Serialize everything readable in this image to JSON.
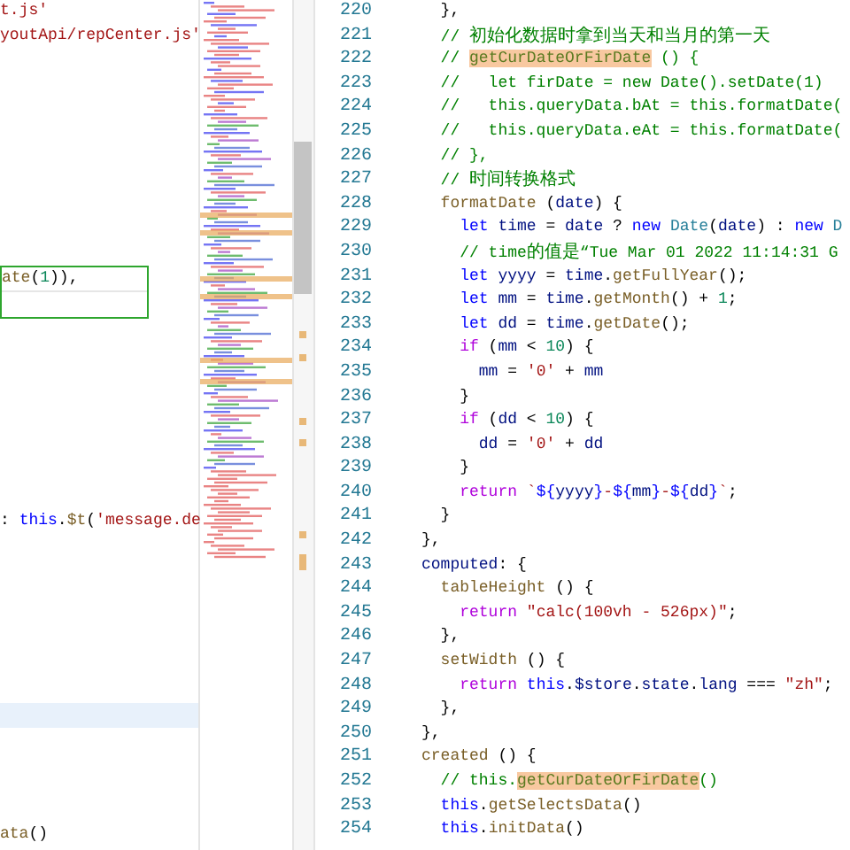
{
  "left_pane": {
    "lines": [
      {
        "kind": "code",
        "tokens": [
          {
            "kind": "string",
            "text": "t.js'"
          }
        ]
      },
      {
        "kind": "code",
        "tokens": [
          {
            "kind": "string",
            "text": "youtApi/repCenter.js'"
          }
        ]
      },
      {
        "kind": "blank"
      },
      {
        "kind": "blank"
      },
      {
        "kind": "blank"
      },
      {
        "kind": "blank"
      },
      {
        "kind": "blank"
      },
      {
        "kind": "blank"
      },
      {
        "kind": "blank"
      },
      {
        "kind": "blank"
      },
      {
        "kind": "blank"
      },
      {
        "kind": "code",
        "boxed": true,
        "tokens": [
          {
            "kind": "function",
            "text": "ate"
          },
          {
            "kind": "plain",
            "text": "("
          },
          {
            "kind": "number",
            "text": "1"
          },
          {
            "kind": "plain",
            "text": ")),"
          }
        ]
      },
      {
        "kind": "blank",
        "boxed": true
      },
      {
        "kind": "blank"
      },
      {
        "kind": "blank"
      },
      {
        "kind": "blank"
      },
      {
        "kind": "blank"
      },
      {
        "kind": "blank"
      },
      {
        "kind": "blank"
      },
      {
        "kind": "blank"
      },
      {
        "kind": "blank"
      },
      {
        "kind": "code",
        "tokens": [
          {
            "kind": "plain",
            "text": ": "
          },
          {
            "kind": "keyword",
            "text": "this"
          },
          {
            "kind": "plain",
            "text": "."
          },
          {
            "kind": "function",
            "text": "$t"
          },
          {
            "kind": "plain",
            "text": "("
          },
          {
            "kind": "string",
            "text": "'message.de"
          }
        ]
      },
      {
        "kind": "blank"
      },
      {
        "kind": "blank"
      },
      {
        "kind": "blank"
      },
      {
        "kind": "blank"
      },
      {
        "kind": "blank"
      },
      {
        "kind": "blank"
      },
      {
        "kind": "blank"
      },
      {
        "kind": "blank",
        "current": true
      },
      {
        "kind": "blank"
      },
      {
        "kind": "blank"
      },
      {
        "kind": "blank"
      },
      {
        "kind": "blank"
      },
      {
        "kind": "code",
        "tokens": [
          {
            "kind": "function",
            "text": "ata"
          },
          {
            "kind": "plain",
            "text": "()"
          }
        ]
      }
    ]
  },
  "editor": {
    "lines": [
      {
        "number": "220",
        "tokens": [
          {
            "kind": "plain",
            "text": "  },"
          }
        ]
      },
      {
        "number": "221",
        "tokens": [
          {
            "kind": "comment",
            "text": "  // "
          },
          {
            "kind": "comment-cjk",
            "text": "初始化数据时拿到当天和当月的第一天"
          }
        ]
      },
      {
        "number": "222",
        "tokens": [
          {
            "kind": "comment",
            "text": "  // "
          },
          {
            "kind": "match",
            "text": "getCurDateOrFirDate"
          },
          {
            "kind": "comment",
            "text": " () {"
          }
        ]
      },
      {
        "number": "223",
        "tokens": [
          {
            "kind": "comment",
            "text": "  //   let firDate = new Date().setDate(1)"
          }
        ]
      },
      {
        "number": "224",
        "tokens": [
          {
            "kind": "comment",
            "text": "  //   this.queryData.bAt = this.formatDate("
          }
        ]
      },
      {
        "number": "225",
        "tokens": [
          {
            "kind": "comment",
            "text": "  //   this.queryData.eAt = this.formatDate("
          }
        ]
      },
      {
        "number": "226",
        "tokens": [
          {
            "kind": "comment",
            "text": "  // },"
          }
        ]
      },
      {
        "number": "227",
        "tokens": [
          {
            "kind": "comment",
            "text": "  // "
          },
          {
            "kind": "comment-cjk",
            "text": "时间转换格式"
          }
        ]
      },
      {
        "number": "228",
        "tokens": [
          {
            "kind": "function",
            "text": "  formatDate"
          },
          {
            "kind": "plain",
            "text": " ("
          },
          {
            "kind": "variable",
            "text": "date"
          },
          {
            "kind": "plain",
            "text": ") {"
          }
        ]
      },
      {
        "number": "229",
        "tokens": [
          {
            "kind": "keyword",
            "text": "    let "
          },
          {
            "kind": "variable",
            "text": "time"
          },
          {
            "kind": "plain",
            "text": " = "
          },
          {
            "kind": "variable",
            "text": "date"
          },
          {
            "kind": "plain",
            "text": " ? "
          },
          {
            "kind": "keyword",
            "text": "new "
          },
          {
            "kind": "class",
            "text": "Date"
          },
          {
            "kind": "plain",
            "text": "("
          },
          {
            "kind": "variable",
            "text": "date"
          },
          {
            "kind": "plain",
            "text": ") : "
          },
          {
            "kind": "keyword",
            "text": "new "
          },
          {
            "kind": "class",
            "text": "D"
          }
        ]
      },
      {
        "number": "230",
        "tokens": [
          {
            "kind": "comment",
            "text": "    // time"
          },
          {
            "kind": "comment-cjk",
            "text": "的值是"
          },
          {
            "kind": "comment",
            "text": "“Tue Mar 01 2022 11:14:31 G"
          }
        ]
      },
      {
        "number": "231",
        "tokens": [
          {
            "kind": "keyword",
            "text": "    let "
          },
          {
            "kind": "variable",
            "text": "yyyy"
          },
          {
            "kind": "plain",
            "text": " = "
          },
          {
            "kind": "variable",
            "text": "time"
          },
          {
            "kind": "plain",
            "text": "."
          },
          {
            "kind": "function",
            "text": "getFullYear"
          },
          {
            "kind": "plain",
            "text": "();"
          }
        ]
      },
      {
        "number": "232",
        "tokens": [
          {
            "kind": "keyword",
            "text": "    let "
          },
          {
            "kind": "variable",
            "text": "mm"
          },
          {
            "kind": "plain",
            "text": " = "
          },
          {
            "kind": "variable",
            "text": "time"
          },
          {
            "kind": "plain",
            "text": "."
          },
          {
            "kind": "function",
            "text": "getMonth"
          },
          {
            "kind": "plain",
            "text": "() + "
          },
          {
            "kind": "number",
            "text": "1"
          },
          {
            "kind": "plain",
            "text": ";"
          }
        ]
      },
      {
        "number": "233",
        "tokens": [
          {
            "kind": "keyword",
            "text": "    let "
          },
          {
            "kind": "variable",
            "text": "dd"
          },
          {
            "kind": "plain",
            "text": " = "
          },
          {
            "kind": "variable",
            "text": "time"
          },
          {
            "kind": "plain",
            "text": "."
          },
          {
            "kind": "function",
            "text": "getDate"
          },
          {
            "kind": "plain",
            "text": "();"
          }
        ]
      },
      {
        "number": "234",
        "tokens": [
          {
            "kind": "control",
            "text": "    if"
          },
          {
            "kind": "plain",
            "text": " ("
          },
          {
            "kind": "variable",
            "text": "mm"
          },
          {
            "kind": "plain",
            "text": " < "
          },
          {
            "kind": "number",
            "text": "10"
          },
          {
            "kind": "plain",
            "text": ") {"
          }
        ]
      },
      {
        "number": "235",
        "tokens": [
          {
            "kind": "variable",
            "text": "      mm"
          },
          {
            "kind": "plain",
            "text": " = "
          },
          {
            "kind": "string",
            "text": "'0'"
          },
          {
            "kind": "plain",
            "text": " + "
          },
          {
            "kind": "variable",
            "text": "mm"
          }
        ]
      },
      {
        "number": "236",
        "tokens": [
          {
            "kind": "plain",
            "text": "    }"
          }
        ]
      },
      {
        "number": "237",
        "tokens": [
          {
            "kind": "control",
            "text": "    if"
          },
          {
            "kind": "plain",
            "text": " ("
          },
          {
            "kind": "variable",
            "text": "dd"
          },
          {
            "kind": "plain",
            "text": " < "
          },
          {
            "kind": "number",
            "text": "10"
          },
          {
            "kind": "plain",
            "text": ") {"
          }
        ]
      },
      {
        "number": "238",
        "tokens": [
          {
            "kind": "variable",
            "text": "      dd"
          },
          {
            "kind": "plain",
            "text": " = "
          },
          {
            "kind": "string",
            "text": "'0'"
          },
          {
            "kind": "plain",
            "text": " + "
          },
          {
            "kind": "variable",
            "text": "dd"
          }
        ]
      },
      {
        "number": "239",
        "tokens": [
          {
            "kind": "plain",
            "text": "    }"
          }
        ]
      },
      {
        "number": "240",
        "tokens": [
          {
            "kind": "control",
            "text": "    return "
          },
          {
            "kind": "string",
            "text": "`"
          },
          {
            "kind": "keyword",
            "text": "${"
          },
          {
            "kind": "variable",
            "text": "yyyy"
          },
          {
            "kind": "keyword",
            "text": "}"
          },
          {
            "kind": "string",
            "text": "-"
          },
          {
            "kind": "keyword",
            "text": "${"
          },
          {
            "kind": "variable",
            "text": "mm"
          },
          {
            "kind": "keyword",
            "text": "}"
          },
          {
            "kind": "string",
            "text": "-"
          },
          {
            "kind": "keyword",
            "text": "${"
          },
          {
            "kind": "variable",
            "text": "dd"
          },
          {
            "kind": "keyword",
            "text": "}"
          },
          {
            "kind": "string",
            "text": "`"
          },
          {
            "kind": "plain",
            "text": ";"
          }
        ]
      },
      {
        "number": "241",
        "tokens": [
          {
            "kind": "plain",
            "text": "  }"
          }
        ]
      },
      {
        "number": "242",
        "tokens": [
          {
            "kind": "plain",
            "text": "},"
          }
        ]
      },
      {
        "number": "243",
        "tokens": [
          {
            "kind": "variable",
            "text": "computed"
          },
          {
            "kind": "plain",
            "text": ": {"
          }
        ]
      },
      {
        "number": "244",
        "tokens": [
          {
            "kind": "function",
            "text": "  tableHeight"
          },
          {
            "kind": "plain",
            "text": " () {"
          }
        ]
      },
      {
        "number": "245",
        "tokens": [
          {
            "kind": "control",
            "text": "    return "
          },
          {
            "kind": "string",
            "text": "\"calc(100vh - 526px)\""
          },
          {
            "kind": "plain",
            "text": ";"
          }
        ]
      },
      {
        "number": "246",
        "tokens": [
          {
            "kind": "plain",
            "text": "  },"
          }
        ]
      },
      {
        "number": "247",
        "tokens": [
          {
            "kind": "function",
            "text": "  setWidth"
          },
          {
            "kind": "plain",
            "text": " () {"
          }
        ]
      },
      {
        "number": "248",
        "tokens": [
          {
            "kind": "control",
            "text": "    return "
          },
          {
            "kind": "keyword",
            "text": "this"
          },
          {
            "kind": "plain",
            "text": "."
          },
          {
            "kind": "variable",
            "text": "$store"
          },
          {
            "kind": "plain",
            "text": "."
          },
          {
            "kind": "variable",
            "text": "state"
          },
          {
            "kind": "plain",
            "text": "."
          },
          {
            "kind": "variable",
            "text": "lang"
          },
          {
            "kind": "plain",
            "text": " === "
          },
          {
            "kind": "string",
            "text": "\"zh\""
          },
          {
            "kind": "plain",
            "text": ";"
          }
        ]
      },
      {
        "number": "249",
        "tokens": [
          {
            "kind": "plain",
            "text": "  },"
          }
        ]
      },
      {
        "number": "250",
        "tokens": [
          {
            "kind": "plain",
            "text": "},"
          }
        ]
      },
      {
        "number": "251",
        "tokens": [
          {
            "kind": "function",
            "text": "created"
          },
          {
            "kind": "plain",
            "text": " () {"
          }
        ]
      },
      {
        "number": "252",
        "tokens": [
          {
            "kind": "comment",
            "text": "  // this."
          },
          {
            "kind": "match",
            "text": "getCurDateOrFirDate"
          },
          {
            "kind": "comment",
            "text": "()"
          }
        ]
      },
      {
        "number": "253",
        "tokens": [
          {
            "kind": "keyword",
            "text": "  this"
          },
          {
            "kind": "plain",
            "text": "."
          },
          {
            "kind": "function",
            "text": "getSelectsData"
          },
          {
            "kind": "plain",
            "text": "()"
          }
        ]
      },
      {
        "number": "254",
        "tokens": [
          {
            "kind": "keyword",
            "text": "  this"
          },
          {
            "kind": "plain",
            "text": "."
          },
          {
            "kind": "function",
            "text": "initData"
          },
          {
            "kind": "plain",
            "text": "()"
          }
        ]
      }
    ]
  }
}
